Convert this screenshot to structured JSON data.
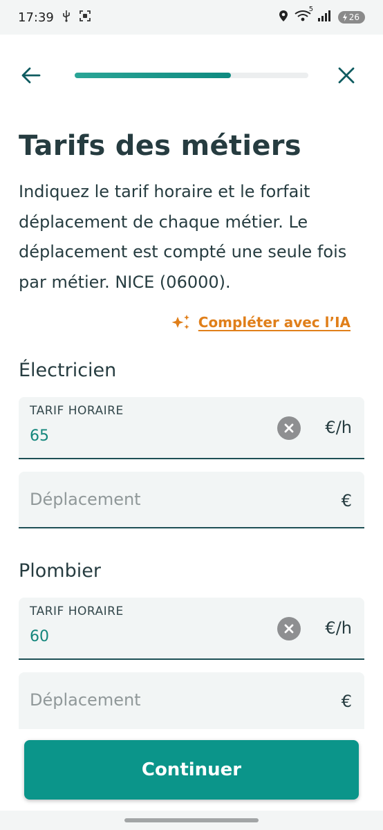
{
  "status_bar": {
    "time": "17:39",
    "network_tag": "5",
    "battery": "26",
    "icons": [
      "usb-icon",
      "screenshot-icon",
      "location-icon",
      "wifi-icon",
      "signal-icon",
      "battery-charging-icon"
    ]
  },
  "nav": {
    "progress": 0.67,
    "back_icon": "arrow-left-icon",
    "close_icon": "close-icon"
  },
  "page": {
    "title": "Tarifs des métiers",
    "description": "Indiquez le tarif horaire et le forfait déplacement de chaque métier. Le déplacement est compté une seule fois par métier. NICE (06000).",
    "ai_link": "Compléter avec l’IA"
  },
  "trades": [
    {
      "name": "Électricien",
      "hourly_label": "TARIF HORAIRE",
      "hourly_value": "65",
      "hourly_unit": "€/h",
      "travel_placeholder": "Déplacement",
      "travel_unit": "€"
    },
    {
      "name": "Plombier",
      "hourly_label": "TARIF HORAIRE",
      "hourly_value": "60",
      "hourly_unit": "€/h",
      "travel_placeholder": "Déplacement",
      "travel_unit": "€"
    }
  ],
  "footer": {
    "continue_label": "Continuer"
  },
  "colors": {
    "accent": "#0b958a",
    "link": "#e07f1a",
    "text": "#263c40",
    "field_bg": "#f2f5f5"
  }
}
